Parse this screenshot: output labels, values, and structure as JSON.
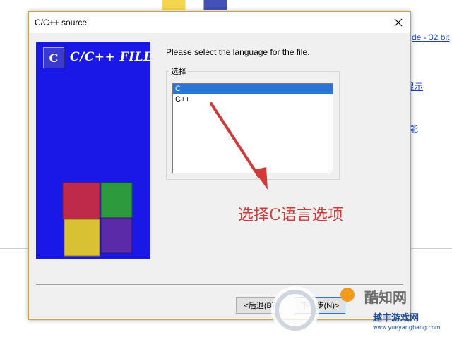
{
  "background": {
    "links": [
      "de - 32 bit",
      "显示",
      "能"
    ]
  },
  "dialog": {
    "title": "C/C++ source",
    "banner_text": "C/C++ FILE",
    "banner_logo_letter": "C",
    "prompt": "Please select the language for the file.",
    "group_label": "选择",
    "list": {
      "items": [
        "C",
        "C++"
      ],
      "selected": "C"
    },
    "annotation": "选择C语言选项",
    "buttons": {
      "back": "<后退(B)",
      "next": "下一步(N)>"
    }
  },
  "watermark": {
    "text1": "酷知网",
    "text2": "越丰游戏网",
    "url": "www.yueyangbang.com"
  },
  "colors": {
    "banner_blue": "#1a18e6",
    "selection_blue": "#2a74d6",
    "annotation_red": "#d23a3a",
    "arrow_red": "#d23a3a"
  },
  "icons": [
    "close-icon",
    "cpp-file-logo-icon",
    "cubes-graphic-icon",
    "red-arrow-icon"
  ]
}
